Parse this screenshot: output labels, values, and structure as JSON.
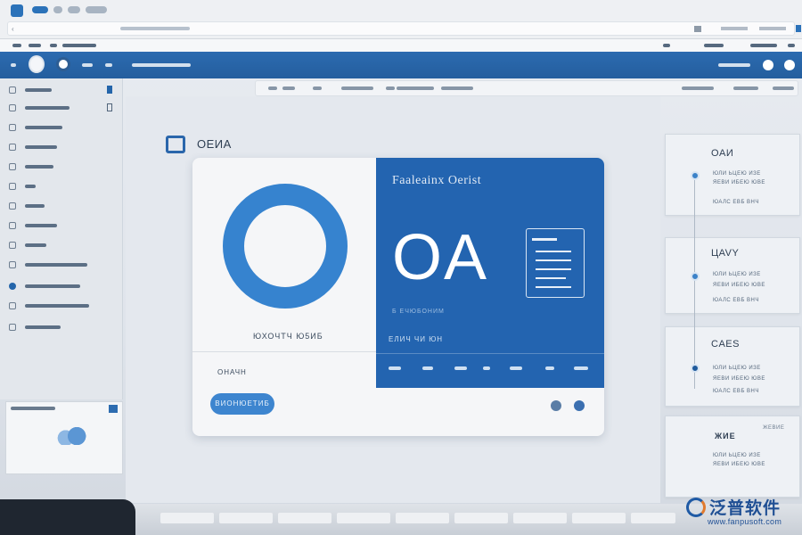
{
  "card": {
    "brand_name": "OЕИA",
    "caption": "ЮХОЧТЧ Ю5ИБ",
    "label": "ОНАЧН",
    "button_label": "ВИОНЮЕТИБ"
  },
  "blue_panel": {
    "title": "Faaleainx Oerist",
    "logo_text": "OA",
    "subtitle": "Б ЕЧЮБОНИМ",
    "label": "ЕЛИЧ ЧИ ЮН"
  },
  "timeline": {
    "items": [
      {
        "title": "OAИ",
        "text": [
          "ЮЛИ ЬЦЕЮ ИЗЕ",
          "ЯЕВИ ИБЕЮ ЮВЕ",
          "ЮАЛС ЕВБ ВНЧ"
        ]
      },
      {
        "title": "ЦAVY",
        "text": [
          "ЮЛИ ЬЦЕЮ ИЗЕ",
          "ЯЕВИ ИБЕЮ ЮВЕ",
          "ЮАЛС ЕВБ ВНЧ"
        ]
      },
      {
        "title": "CAES",
        "text": [
          "ЮЛИ ЬЦЕЮ ИЗЕ",
          "ЯЕВИ ИБЕЮ ЮВЕ",
          "ЮАЛС ЕВБ ВНЧ"
        ]
      }
    ],
    "bottom_title": "ЖИЕ",
    "bottom_note": "ЖЕВИЕ"
  },
  "watermark": {
    "name": "泛普软件",
    "url": "www.fanpusoft.com"
  },
  "colors": {
    "primary": "#2364b0",
    "ring": "#3683cf",
    "header": "#2c6bb0",
    "accent": "#e07a2e"
  }
}
